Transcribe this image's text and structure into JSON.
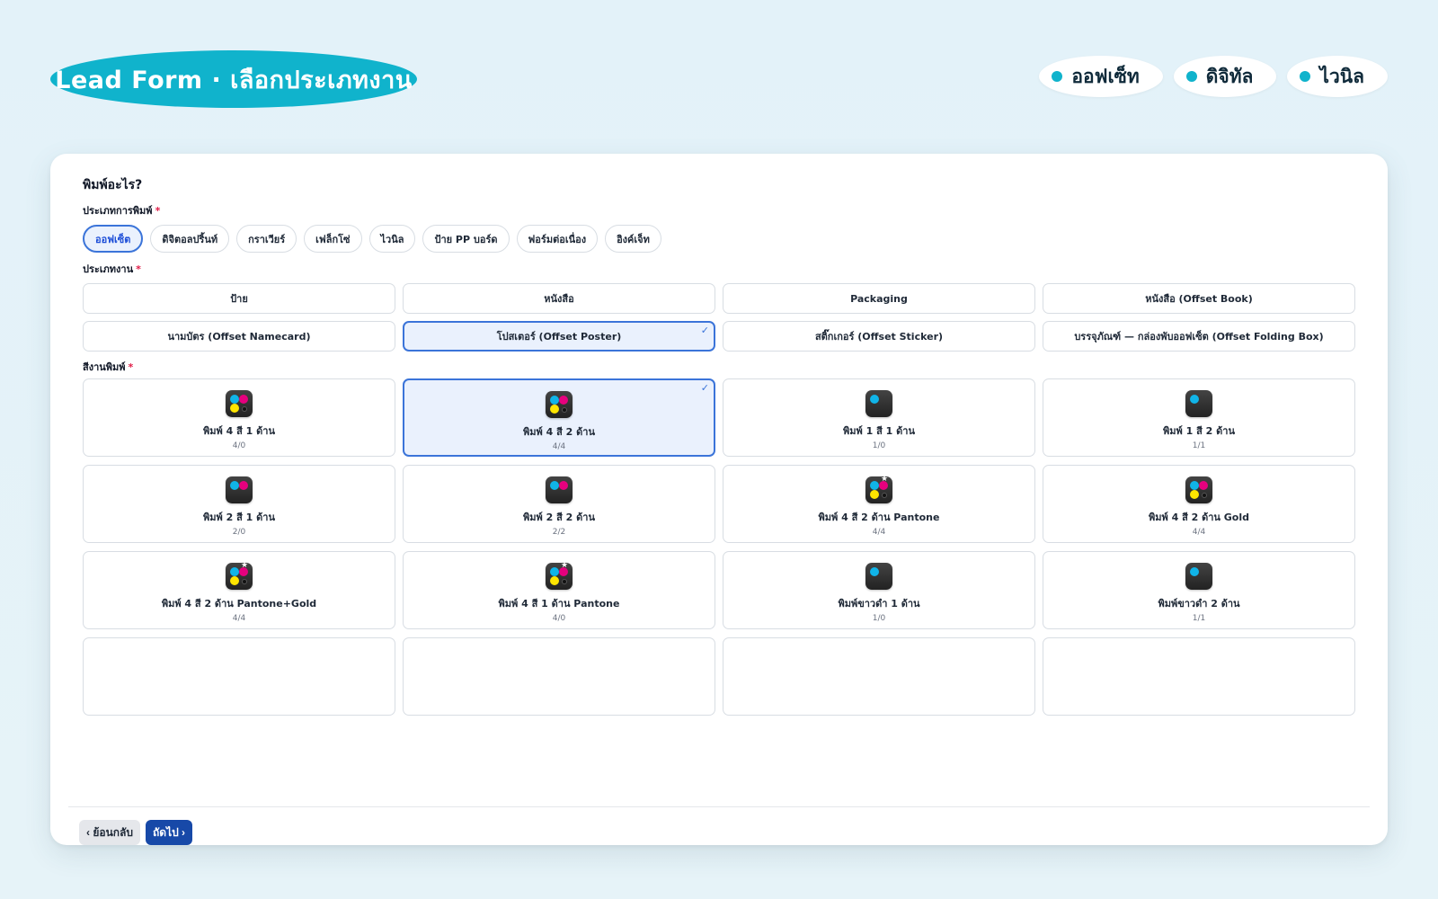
{
  "header": {
    "title": "Lead Form · เลือกประเภทงาน",
    "chips": [
      "ออฟเซ็ท",
      "ดิจิทัล",
      "ไวนิล"
    ]
  },
  "form": {
    "question": "พิมพ์อะไร?",
    "print_type_label": "ประเภทการพิมพ์",
    "print_types": [
      "ออฟเซ็ต",
      "ดิจิตอลปริ้นท์",
      "กราเวียร์",
      "เฟล็กโซ่",
      "ไวนิล",
      "ป้าย PP บอร์ด",
      "ฟอร์มต่อเนื่อง",
      "อิงค์เจ็ท"
    ],
    "print_type_selected": "ออฟเซ็ต",
    "job_type_label": "ประเภทงาน",
    "job_types": [
      "ป้าย",
      "หนังสือ",
      "Packaging",
      "หนังสือ (Offset Book)",
      "นามบัตร (Offset Namecard)",
      "โปสเตอร์ (Offset Poster)",
      "สติ๊กเกอร์ (Offset Sticker)",
      "บรรจุภัณฑ์ — กล่องพับออฟเซ็ต (Offset Folding Box)"
    ],
    "job_type_selected": "โปสเตอร์ (Offset Poster)",
    "color_label": "สีงานพิมพ์",
    "colors": [
      {
        "name": "พิมพ์ 4 สี 1 ด้าน",
        "code": "4/0",
        "icon": "cmyk-icon"
      },
      {
        "name": "พิมพ์ 4 สี 2 ด้าน",
        "code": "4/4",
        "icon": "cmyk-icon"
      },
      {
        "name": "พิมพ์ 1 สี 1 ด้าน",
        "code": "1/0",
        "icon": "single-color-icon"
      },
      {
        "name": "พิมพ์ 1 สี 2 ด้าน",
        "code": "1/1",
        "icon": "single-color-icon"
      },
      {
        "name": "พิมพ์ 2 สี 1 ด้าน",
        "code": "2/0",
        "icon": "two-color-icon"
      },
      {
        "name": "พิมพ์ 2 สี 2 ด้าน",
        "code": "2/2",
        "icon": "two-color-icon"
      },
      {
        "name": "พิมพ์ 4 สี 2 ด้าน Pantone",
        "code": "4/4",
        "icon": "cmyk-special-icon"
      },
      {
        "name": "พิมพ์ 4 สี 2 ด้าน Gold",
        "code": "4/4",
        "icon": "cmyk-icon"
      },
      {
        "name": "พิมพ์ 4 สี 2 ด้าน Pantone+Gold",
        "code": "4/4",
        "icon": "cmyk-special-icon"
      },
      {
        "name": "พิมพ์ 4 สี 1 ด้าน Pantone",
        "code": "4/0",
        "icon": "cmyk-special-icon"
      },
      {
        "name": "พิมพ์ขาวดำ 1 ด้าน",
        "code": "1/0",
        "icon": "single-color-icon"
      },
      {
        "name": "พิมพ์ขาวดำ 2 ด้าน",
        "code": "1/1",
        "icon": "single-color-icon"
      }
    ],
    "color_selected": "พิมพ์ 4 สี 2 ด้าน",
    "back_label": "‹ ย้อนกลับ",
    "next_label": "ถัดไป ›"
  },
  "theme": {
    "accent": "#10b3cc",
    "selected_border": "#3b74d9",
    "selected_bg": "#eaf1fd",
    "next_button": "#1749a8",
    "required": "#e11d48"
  }
}
